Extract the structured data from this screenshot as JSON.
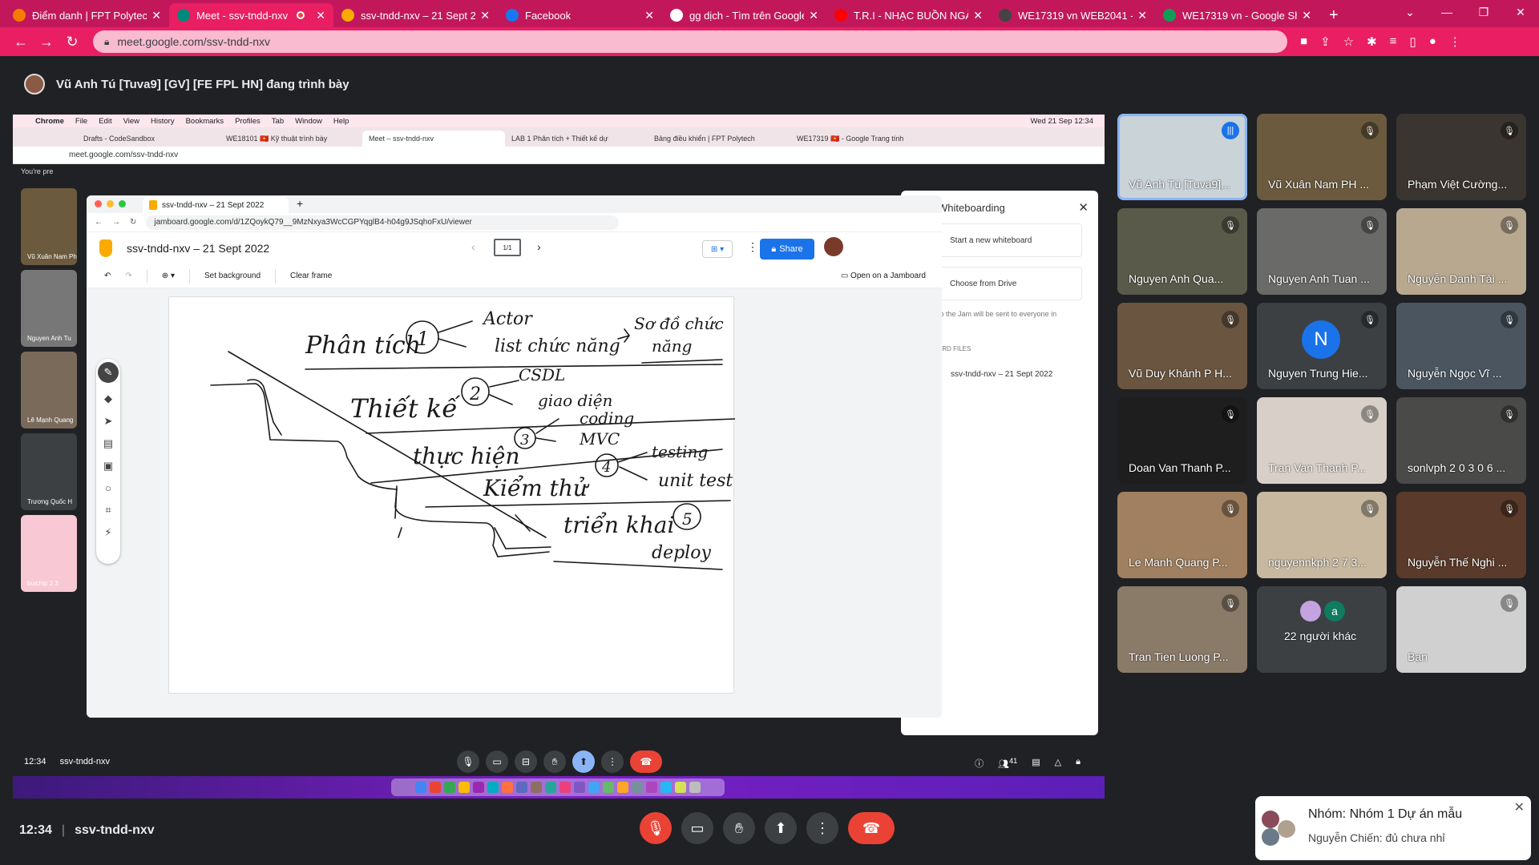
{
  "browser": {
    "tabs": [
      {
        "title": "Điểm danh | FPT Polytechn",
        "favicon_color": "#f57c00"
      },
      {
        "title": "Meet - ssv-tndd-nxv",
        "favicon_color": "#00897b",
        "active": true,
        "recording": true
      },
      {
        "title": "ssv-tndd-nxv – 21 Sept 20",
        "favicon_color": "#f9ab00"
      },
      {
        "title": "Facebook",
        "favicon_color": "#1877f2"
      },
      {
        "title": "gg dịch - Tìm trên Google",
        "favicon_color": "#ffffff"
      },
      {
        "title": "T.R.I - NHẠC BUỒN NGÀY",
        "favicon_color": "#ff0000"
      },
      {
        "title": "WE17319 vn WEB2041 - D",
        "favicon_color": "#444444"
      },
      {
        "title": "WE17319 vn - Google She",
        "favicon_color": "#0f9d58"
      }
    ],
    "url": "meet.google.com/ssv-tndd-nxv",
    "new_tab": "+"
  },
  "presenter_bar": {
    "text": "Vũ Anh Tú [Tuva9] [GV] [FE FPL HN] đang trình bày"
  },
  "shared_screen": {
    "mac_menu": [
      "Chrome",
      "File",
      "Edit",
      "View",
      "History",
      "Bookmarks",
      "Profiles",
      "Tab",
      "Window",
      "Help"
    ],
    "mac_clock": "Wed 21 Sep  12:34",
    "inner_tabs": [
      "Drafts - CodeSandbox",
      "WE18101 🇻🇳 Kỹ thuật trình bày",
      "Meet – ssv-tndd-nxv",
      "LAB 1 Phân tích + Thiết kế dự",
      "Bảng điều khiển | FPT Polytech",
      "WE17319 🇻🇳 - Google Trang tính"
    ],
    "inner_url": "meet.google.com/ssv-tndd-nxv",
    "youre_presenting": "You're pre",
    "left_tiles": [
      "Vũ Xuân Nam Ph",
      "Nguyen Anh Tu",
      "Lê Mạnh Quang",
      "Trương Quốc H",
      "buichip 2 3"
    ],
    "whiteboard_panel": {
      "title": "Whiteboarding",
      "options": [
        "Start a new whiteboard",
        "Choose from Drive"
      ],
      "note": "to the Jam will be sent to everyone in",
      "section": "ARD FILES",
      "file": "ssv-tndd-nxv – 21 Sept 2022"
    },
    "inner_footer": {
      "time": "12:34",
      "code": "ssv-tndd-nxv",
      "participant_count": "41"
    }
  },
  "jamboard": {
    "tab_title": "ssv-tndd-nxv – 21 Sept 2022",
    "url": "jamboard.google.com/d/1ZQoykQ79__9MzNxya3WcCGPYqglB4-h04g9JSqhoFxU/viewer",
    "title": "ssv-tndd-nxv – 21 Sept 2022",
    "page": "1/1",
    "share": "Share",
    "toolbar": {
      "set_background": "Set background",
      "clear_frame": "Clear frame",
      "open_on_jamboard": "Open on a Jamboard"
    },
    "handwriting": {
      "step1": "Phân tích",
      "n1": "1",
      "actor": "Actor",
      "list": "list chức năng",
      "sodo": "Sơ đồ chức",
      "nang": "năng",
      "step2": "Thiết kế",
      "n2": "2",
      "csdl": "CSDL",
      "giaodien": "giao diện",
      "step3": "thực hiện",
      "n3": "3",
      "coding": "coding",
      "mvc": "MVC",
      "step4": "Kiểm thử",
      "n4": "4",
      "testing": "testing",
      "unittest": "unit test",
      "step5": "triển khai",
      "n5": "5",
      "deploy": "deploy"
    }
  },
  "participants": [
    {
      "name": "Vũ Anh Tú [Tuva9]...",
      "bg": "#c9d3d8",
      "speaking": true
    },
    {
      "name": "Vũ Xuân Nam PH ...",
      "bg": "#6b5a3e"
    },
    {
      "name": "Phạm Việt Cường...",
      "bg": "#3a3530"
    },
    {
      "name": "Nguyen Anh Qua...",
      "bg": "#5a5a4a"
    },
    {
      "name": "Nguyen Anh Tuan ...",
      "bg": "#6a6a68"
    },
    {
      "name": "Nguyễn Danh Tài ...",
      "bg": "#b8a890"
    },
    {
      "name": "Vũ Duy Khánh P H...",
      "bg": "#6a5540"
    },
    {
      "name": "Nguyen Trung Hie...",
      "bg": "#3c4043",
      "letter": "N",
      "letter_bg": "#1a73e8"
    },
    {
      "name": "Nguyễn Ngọc Vĩ ...",
      "bg": "#4a5560"
    },
    {
      "name": "Doan Van Thanh P...",
      "bg": "#1e1e1e"
    },
    {
      "name": "Tran Van Thanh P...",
      "bg": "#d8d0c8"
    },
    {
      "name": "sonlvph 2 0 3 0 6 ...",
      "bg": "#4a4a48"
    },
    {
      "name": "Le Manh Quang P...",
      "bg": "#a08060"
    },
    {
      "name": "nguyennkph 2 7 3...",
      "bg": "#c8b8a0"
    },
    {
      "name": "Nguyễn Thế Nghi ...",
      "bg": "#5a3a2a"
    },
    {
      "name": "Tran Tien Luong P...",
      "bg": "#8a7a68"
    },
    {
      "name": "22 người khác",
      "bg": "#3c4043",
      "others": true
    },
    {
      "name": "Bạn",
      "bg": "#d0d0d0"
    }
  ],
  "bottom_bar": {
    "time": "12:34",
    "code": "ssv-tndd-nxv"
  },
  "chat_popup": {
    "title": "Nhóm: Nhóm 1 Dự án mẫu",
    "message": "Nguyễn Chiến: đủ chưa nhỉ"
  }
}
